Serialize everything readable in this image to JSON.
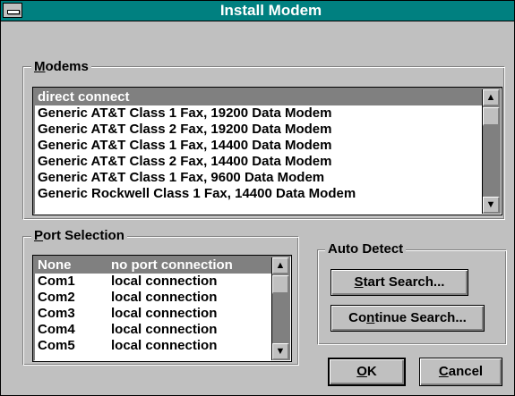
{
  "window": {
    "title": "Install Modem",
    "system_menu_icon": "system-menu-icon"
  },
  "modems": {
    "label_mnemonic": "M",
    "label_rest": "odems",
    "items": [
      "direct connect",
      "Generic AT&T Class 1 Fax, 19200 Data Modem",
      "Generic AT&T Class 2 Fax, 19200 Data Modem",
      "Generic AT&T Class 1 Fax, 14400 Data Modem",
      "Generic AT&T Class 2 Fax, 14400 Data Modem",
      "Generic AT&T Class 1 Fax, 9600 Data Modem",
      "Generic Rockwell Class 1 Fax, 14400 Data Modem"
    ],
    "selected_index": 0,
    "scroll_up_icon": "arrow-up-icon",
    "scroll_down_icon": "arrow-down-icon"
  },
  "port_selection": {
    "label_mnemonic": "P",
    "label_rest": "ort Selection",
    "items": [
      {
        "port": "None",
        "desc": "no port connection"
      },
      {
        "port": "Com1",
        "desc": "local connection"
      },
      {
        "port": "Com2",
        "desc": "local connection"
      },
      {
        "port": "Com3",
        "desc": "local connection"
      },
      {
        "port": "Com4",
        "desc": "local connection"
      },
      {
        "port": "Com5",
        "desc": "local connection"
      }
    ],
    "selected_index": 0
  },
  "auto_detect": {
    "label": "Auto Detect",
    "start_search_mnemonic": "S",
    "start_search_rest": "tart Search...",
    "continue_pre": "Co",
    "continue_mnemonic": "n",
    "continue_rest": "tinue Search..."
  },
  "buttons": {
    "ok_mnemonic": "O",
    "ok_rest": "K",
    "cancel_mnemonic": "C",
    "cancel_rest": "ancel"
  }
}
